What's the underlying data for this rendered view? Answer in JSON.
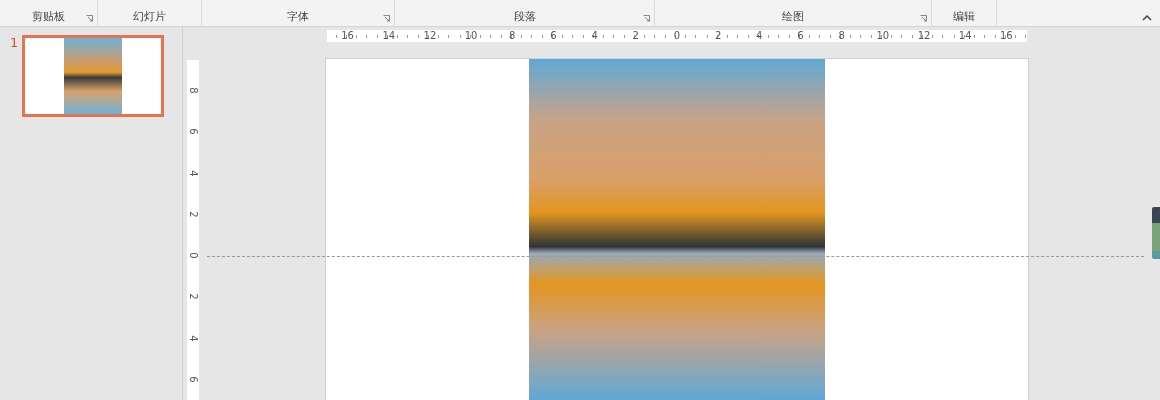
{
  "ribbon": {
    "groups": [
      {
        "label": "剪贴板",
        "launcher": true
      },
      {
        "label": "幻灯片",
        "launcher": false
      },
      {
        "label": "字体",
        "launcher": true
      },
      {
        "label": "段落",
        "launcher": true
      },
      {
        "label": "绘图",
        "launcher": true
      },
      {
        "label": "编辑",
        "launcher": false
      }
    ]
  },
  "slides_panel": {
    "slides": [
      {
        "number": "1",
        "selected": true
      }
    ]
  },
  "horizontal_ruler": [
    "16",
    "14",
    "12",
    "10",
    "8",
    "6",
    "4",
    "2",
    "0",
    "2",
    "4",
    "6",
    "8",
    "10",
    "12",
    "14",
    "16"
  ],
  "vertical_ruler": [
    "8",
    "6",
    "4",
    "2",
    "0",
    "2",
    "4",
    "6"
  ]
}
